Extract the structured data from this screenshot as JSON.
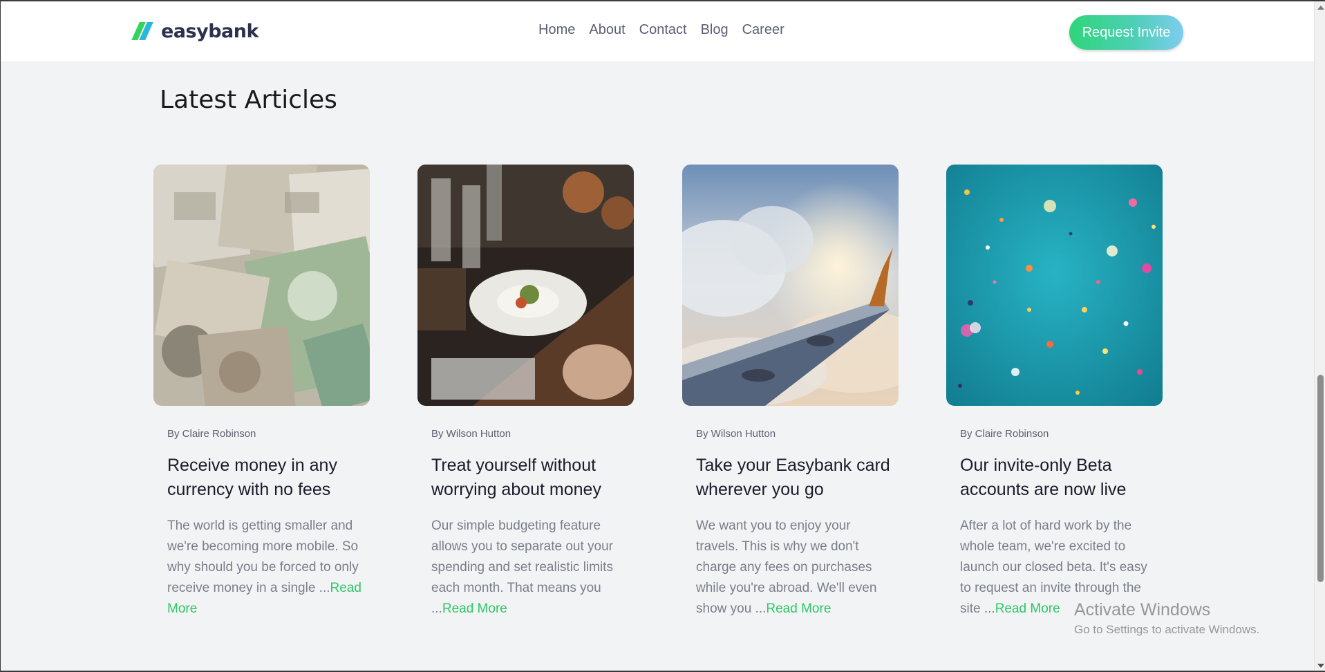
{
  "header": {
    "logo_text": "easybank",
    "nav": [
      "Home",
      "About",
      "Contact",
      "Blog",
      "Career"
    ],
    "invite_label": "Request Invite"
  },
  "section": {
    "title": "Latest Articles"
  },
  "articles": [
    {
      "author": "By Claire Robinson",
      "title": "Receive money in any currency with no fees",
      "excerpt": "The world is getting smaller and we're becoming more mobile. So why should you be forced to only receive money in a single ...",
      "read_more": "Read More",
      "image": "currency-notes-image"
    },
    {
      "author": "By Wilson Hutton",
      "title": "Treat yourself without worrying about money",
      "excerpt": "Our simple budgeting feature allows you to separate out your spending and set realistic limits each month. That means you ...",
      "read_more": "Read More",
      "image": "restaurant-dinner-image"
    },
    {
      "author": "By Wilson Hutton",
      "title": "Take your Easybank card wherever you go",
      "excerpt": "We want you to enjoy your travels. This is why we don't charge any fees on purchases while you're abroad. We'll even show you ...",
      "read_more": "Read More",
      "image": "airplane-wing-image"
    },
    {
      "author": "By Claire Robinson",
      "title": "Our invite-only Beta accounts are now live",
      "excerpt": "After a lot of hard work by the whole team, we're excited to launch our closed beta. It's easy to request an invite through the site ...",
      "read_more": "Read More",
      "image": "confetti-image"
    }
  ],
  "watermark": {
    "title": "Activate Windows",
    "subtitle": "Go to Settings to activate Windows."
  },
  "colors": {
    "brand_green": "#2ec766",
    "brand_cyan": "#2bb7da",
    "text_dark": "#2d314d",
    "background": "#f2f3f5"
  }
}
